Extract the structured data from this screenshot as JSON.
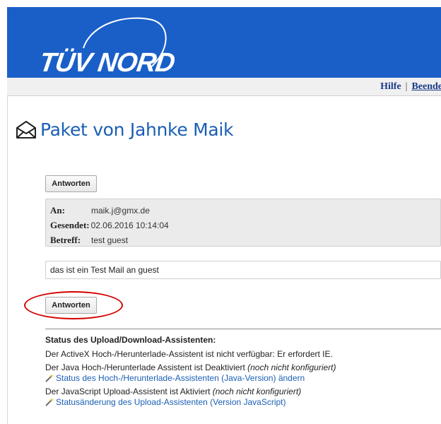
{
  "header": {
    "logo_text": "TÜV NORD",
    "brand_color": "#1a5fc7"
  },
  "menu": {
    "help_label": "Hilfe",
    "separator": "|",
    "exit_label": "Beende"
  },
  "page": {
    "title": "Paket von Jahnke Maik",
    "title_icon": "open-envelope-icon"
  },
  "buttons": {
    "reply_label": "Antworten"
  },
  "message": {
    "to_label": "An:",
    "to_value": "maik.j@gmx.de",
    "sent_label": "Gesendet:",
    "sent_value": "02.06.2016 10:14:04",
    "subject_label": "Betreff:",
    "subject_value": "test guest",
    "body": "das ist ein Test Mail an guest"
  },
  "status": {
    "title": "Status des Upload/Download-Assistenten:",
    "activex": "Der ActiveX Hoch-/Herunterlade-Assistent ist nicht verfügbar: Er erfordert IE.",
    "java_prefix": "Der Java Hoch-/Herunterlade Assistent ist Deaktiviert",
    "java_note": "(noch nicht konfiguriert)",
    "java_link": "Status des Hoch-/Herunterlade-Assistenten (Java-Version) ändern",
    "js_prefix": "Der JavaScript Upload-Assistent ist Aktiviert",
    "js_note": "(noch nicht konfiguriert)",
    "js_link": "Statusänderung des Upload-Assistenten (Version JavaScript)",
    "link_icon": "wand-icon"
  },
  "annotation_color": "#d40000"
}
